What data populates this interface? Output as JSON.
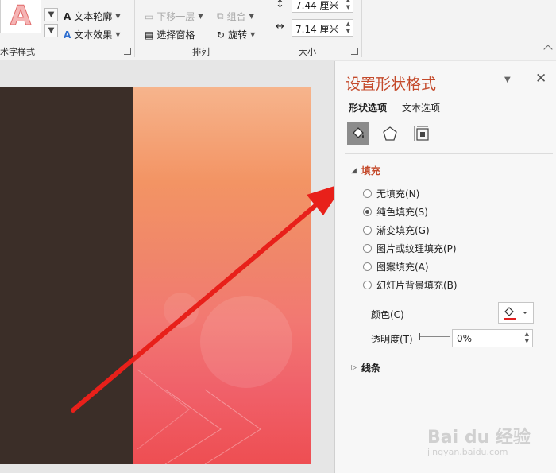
{
  "ribbon": {
    "wordart": {
      "glyph": "A",
      "group_label": "术字样式"
    },
    "text_outline": "文本轮廓",
    "text_effects": "文本效果",
    "arrange": {
      "send_backward": "下移一层",
      "group": "组合",
      "selection_pane": "选择窗格",
      "rotate": "旋转",
      "group_label": "排列"
    },
    "size": {
      "height_value": "7.44 厘米",
      "width_value": "7.14 厘米",
      "group_label": "大小"
    }
  },
  "pane": {
    "title": "设置形状格式",
    "tabs": [
      {
        "label": "形状选项",
        "active": true
      },
      {
        "label": "文本选项",
        "active": false
      }
    ],
    "icons": [
      "fill-line-icon",
      "effects-pentagon-icon",
      "size-properties-icon"
    ],
    "fill": {
      "label": "填充",
      "options": [
        {
          "label": "无填充(N)",
          "selected": false
        },
        {
          "label": "纯色填充(S)",
          "selected": true
        },
        {
          "label": "渐变填充(G)",
          "selected": false
        },
        {
          "label": "图片或纹理填充(P)",
          "selected": false
        },
        {
          "label": "图案填充(A)",
          "selected": false
        },
        {
          "label": "幻灯片背景填充(B)",
          "selected": false
        }
      ],
      "color_label": "颜色(C)",
      "transparency_label": "透明度(T)",
      "transparency_value": "0%"
    },
    "line": {
      "label": "线条"
    }
  },
  "watermark": {
    "text": "Bai du 经验",
    "url": "jingyan.baidu.com"
  },
  "colors": {
    "accent": "#c44a2b",
    "arrow": "#e8201a",
    "slide_dark": "#3b2e28"
  }
}
